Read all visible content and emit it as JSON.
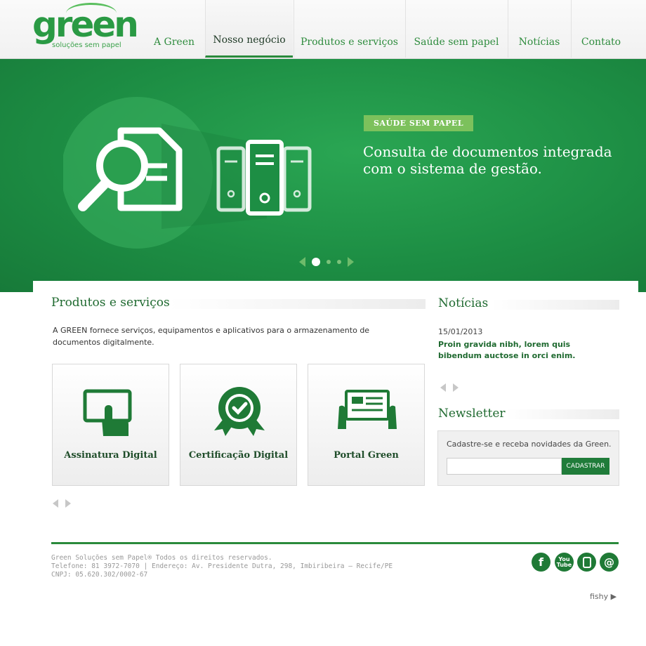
{
  "brand": {
    "name": "green",
    "tagline": "soluções sem papel",
    "color": "#2a9a44"
  },
  "nav": {
    "items": [
      "A Green",
      "Nosso negócio",
      "Produtos e serviços",
      "Saúde sem papel",
      "Notícias",
      "Contato"
    ],
    "active": "Nosso negócio"
  },
  "hero": {
    "tag": "SAÚDE SEM PAPEL",
    "text": "Consulta de documentos integrada com o sistema de gestão.",
    "slides_total": 3,
    "active_slide": 1
  },
  "products": {
    "title": "Produtos e serviços",
    "description": "A GREEN fornece serviços, equipamentos e aplicativos para o armazenamento de documentos digitalmente.",
    "cards": [
      {
        "label": "Assinatura Digital",
        "icon": "tablet-touch-icon"
      },
      {
        "label": "Certificação Digital",
        "icon": "certificate-seal-icon"
      },
      {
        "label": "Portal Green",
        "icon": "document-portal-icon"
      }
    ]
  },
  "news": {
    "title": "Notícias",
    "date": "15/01/2013",
    "headline": "Proin gravida nibh, lorem quis bibendum auctose in orci enim."
  },
  "newsletter": {
    "title": "Newsletter",
    "text": "Cadastre-se e receba novidades da Green.",
    "input_value": "",
    "button": "CADASTRAR"
  },
  "footer": {
    "line1": "Green Soluções sem Papel® Todos os direitos reservados.",
    "line2": "Telefone: 81 3972-7070 | Endereço: Av. Presidente Dutra, 298, Imbiribeira – Recife/PE",
    "line3": "CNPJ: 05.620.302/0002-67",
    "social": [
      "facebook-icon",
      "youtube-icon",
      "mobile-icon",
      "email-icon"
    ],
    "credit": "fishy"
  },
  "colors": {
    "accent": "#2a8a3c",
    "hero": "#1d8e44",
    "tag": "#7cc15c"
  }
}
